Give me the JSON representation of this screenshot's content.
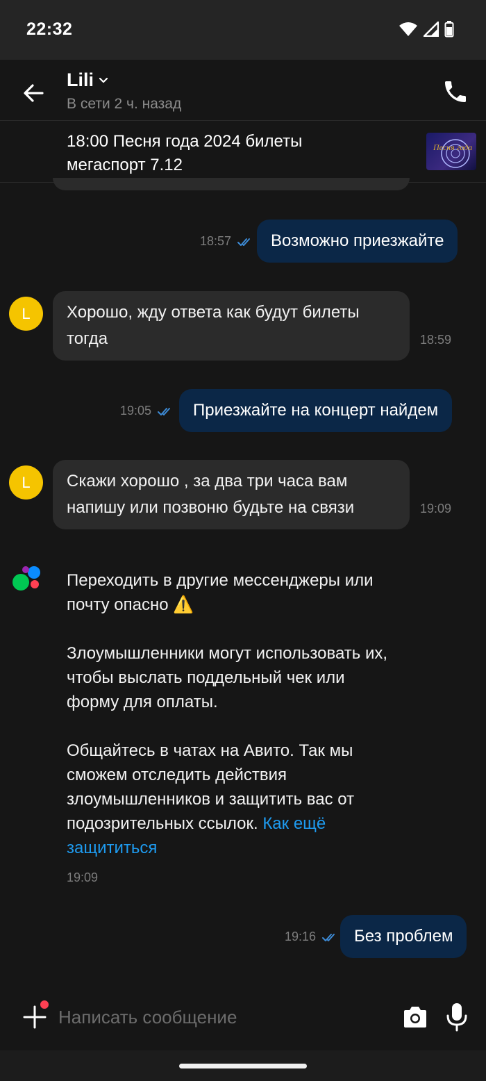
{
  "status_bar": {
    "time": "22:32",
    "icons": [
      "wifi-icon",
      "signal-icon",
      "battery-icon"
    ]
  },
  "header": {
    "contact_name": "Lili",
    "presence": "В сети 2 ч. назад"
  },
  "listing": {
    "title": "18:00 Песня года 2024 билеты мегаспорт 7.12",
    "thumbnail_caption": "Песня года"
  },
  "messages": [
    {
      "direction": "out",
      "text": "Возможно приезжайте",
      "time": "18:57",
      "status": "read"
    },
    {
      "direction": "in",
      "avatar": "L",
      "text": "Хорошо, жду ответа как будут билеты тогда",
      "time": "18:59"
    },
    {
      "direction": "out",
      "text": "Приезжайте на концерт найдем",
      "time": "19:05",
      "status": "read"
    },
    {
      "direction": "in",
      "avatar": "L",
      "text": "Скажи хорошо , за два три часа вам напишу или позвоню будьте на связи",
      "time": "19:09"
    },
    {
      "direction": "out",
      "text": "Без проблем",
      "time": "19:16",
      "status": "read"
    }
  ],
  "system_message": {
    "paragraph_1": "Переходить в другие мессенджеры или почту опасно ⚠️",
    "paragraph_2": "Злоумышленники могут использовать их, чтобы выслать поддельный чек или форму для оплаты.",
    "paragraph_3": "Общайтесь в чатах на Авито. Так мы сможем отследить действия злоумышленников и защитить вас от подозрительных ссылок.",
    "link_text": "Как ещё защититься",
    "time": "19:09"
  },
  "composer": {
    "placeholder": "Написать сообщение"
  },
  "colors": {
    "background": "#161616",
    "outgoing_bubble": "#0b2747",
    "incoming_bubble": "#2b2b2b",
    "link": "#1e9bf0",
    "avatar": "#f5c400",
    "read_check": "#3d8bd6"
  }
}
